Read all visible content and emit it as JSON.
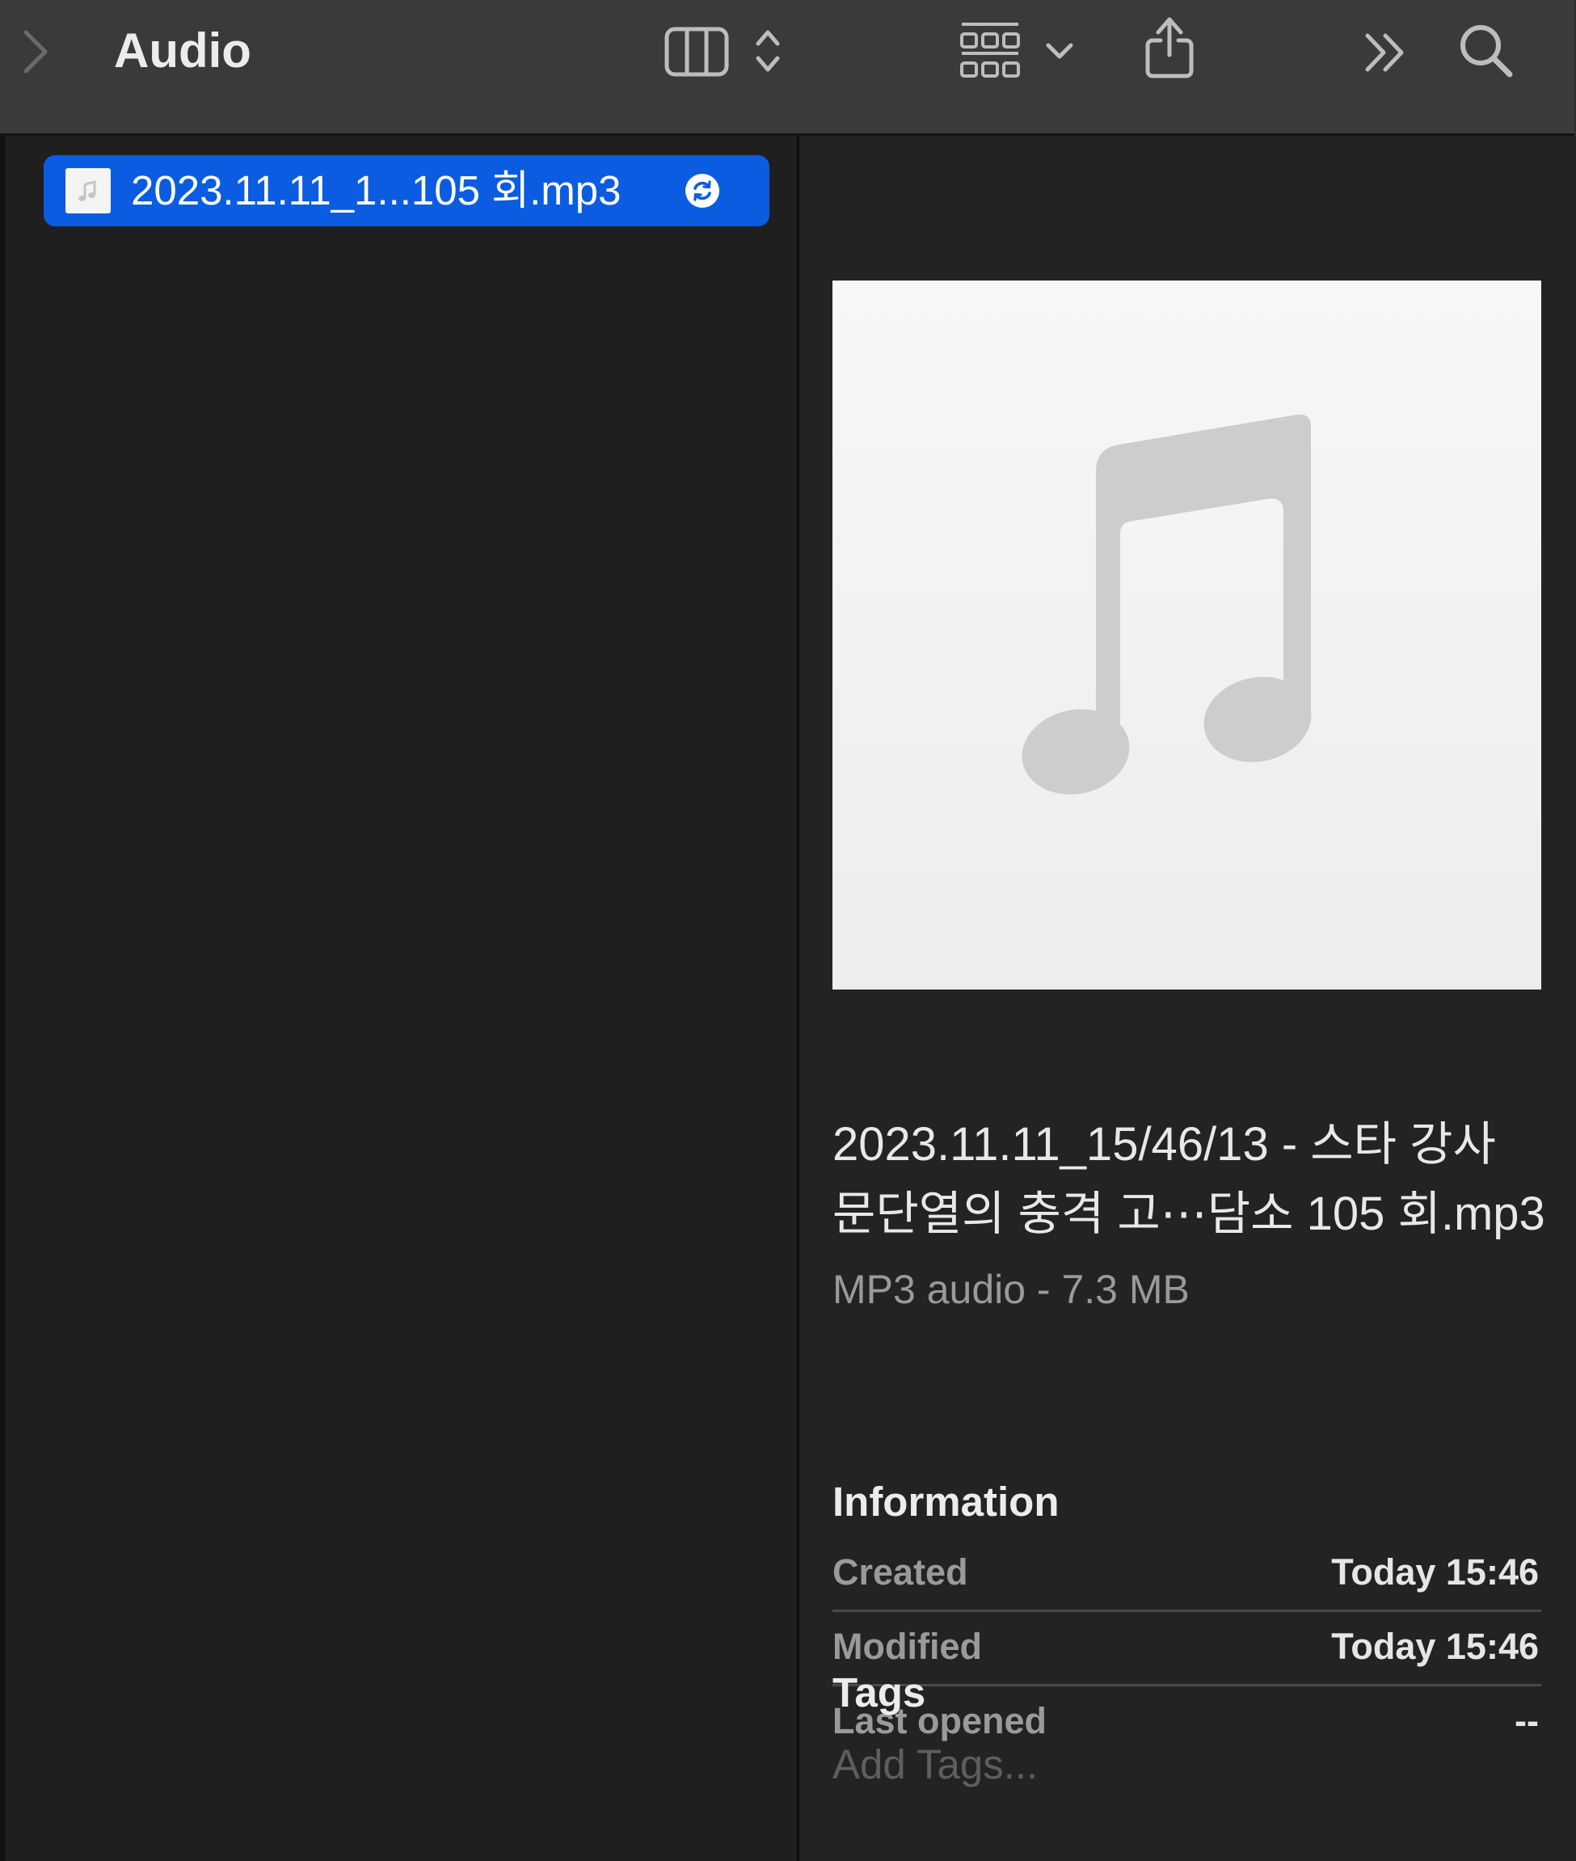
{
  "toolbar": {
    "title": "Audio",
    "icons": {
      "forward": "chevron-right-icon",
      "column_view": "columns-view-icon",
      "view_toggle": "up-down-chevron-icon",
      "group": "grid-group-icon",
      "group_menu": "chevron-down-icon",
      "share": "share-icon",
      "overflow": "double-chevron-right-icon",
      "search": "search-icon"
    }
  },
  "file_list": {
    "items": [
      {
        "name": "2023.11.11_1...105 회.mp3",
        "icon": "audio-file-icon",
        "status_icon": "sync-icon",
        "selected": true
      }
    ]
  },
  "preview": {
    "title": "2023.11.11_15/46/13 - 스타 강사 문단열의 충격 고⋯담소 105 회.mp3",
    "kind": "MP3 audio - 7.3 MB",
    "artwork_icon": "music-note-icon",
    "information_heading": "Information",
    "information": [
      {
        "label": "Created",
        "value": "Today 15:46"
      },
      {
        "label": "Modified",
        "value": "Today 15:46"
      },
      {
        "label": "Last opened",
        "value": "--"
      }
    ],
    "tags_heading": "Tags",
    "tags_placeholder": "Add Tags..."
  },
  "colors": {
    "toolbar_bg": "#3a3a3a",
    "window_bg": "#212121",
    "selection": "#0b5ce0",
    "secondary_text": "#9a9a9a",
    "placeholder_text": "#5e5e5e"
  }
}
